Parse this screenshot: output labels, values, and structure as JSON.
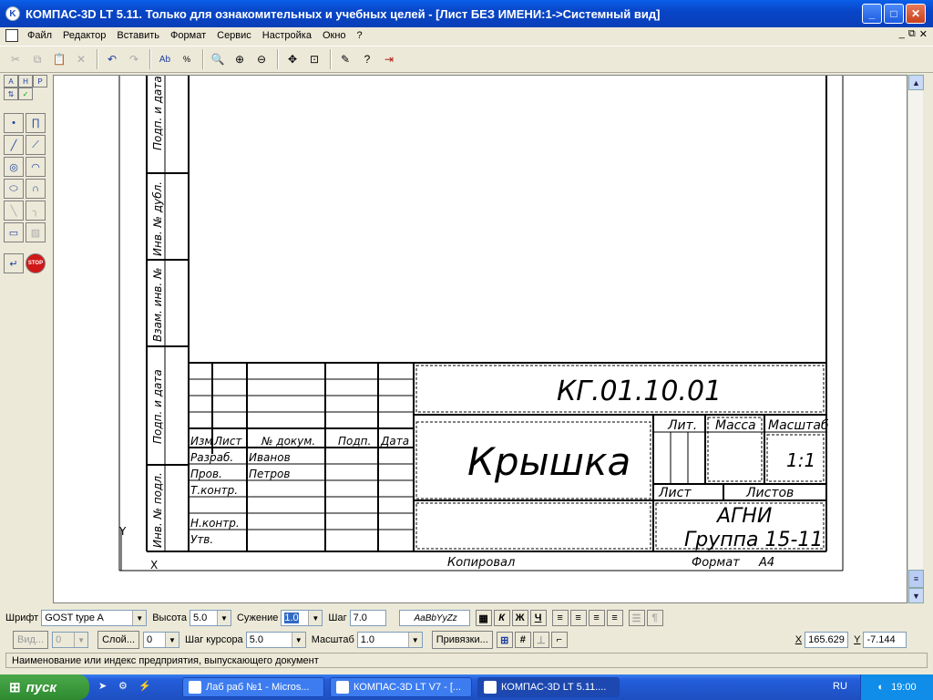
{
  "window": {
    "title": "КОМПАС-3D LT 5.11. Только для ознакомительных и учебных целей - [Лист БЕЗ ИМЕНИ:1->Системный вид]"
  },
  "menu": [
    "Файл",
    "Редактор",
    "Вставить",
    "Формат",
    "Сервис",
    "Настройка",
    "Окно",
    "?"
  ],
  "drawing": {
    "side_labels": [
      "Подп. и дата",
      "Инв. № дубл.",
      "Взам. инв. №",
      "Подп. и дата",
      "Инв. № подл."
    ],
    "stamp": {
      "designation": "КГ.01.10.01",
      "name": "Крышка",
      "org_line1": "АГНИ",
      "org_line2": "Группа 15-11",
      "scale": "1:1",
      "header_cols": [
        "Изм",
        "Лист",
        "№ докум.",
        "Подп.",
        "Дата"
      ],
      "rows": [
        {
          "role": "Разраб.",
          "person": "Иванов"
        },
        {
          "role": "Пров.",
          "person": "Петров"
        },
        {
          "role": "Т.контр.",
          "person": ""
        },
        {
          "role": "",
          "person": ""
        },
        {
          "role": "Н.контр.",
          "person": ""
        },
        {
          "role": "Утв.",
          "person": ""
        }
      ],
      "lit_label": "Лит.",
      "mass_label": "Масса",
      "scale_label": "Масштаб",
      "sheet_label": "Лист",
      "sheets_label": "Листов",
      "copied_label": "Копировал",
      "format_label": "Формат",
      "format_value": "А4"
    },
    "axis_x": "X",
    "axis_y": "Y"
  },
  "params1": {
    "font_label": "Шрифт",
    "font_value": "GOST type A",
    "height_label": "Высота",
    "height_value": "5.0",
    "narrow_label": "Сужение",
    "narrow_value": "1.0",
    "step_label": "Шаг",
    "step_value": "7.0",
    "preview": "AaBbYyZz",
    "italic": "К",
    "bold": "Ж",
    "underline": "Ч"
  },
  "params2": {
    "view_label": "Вид...",
    "view_value": "0",
    "layer_label": "Слой...",
    "layer_value": "0",
    "cursor_label": "Шаг курсора",
    "cursor_value": "5.0",
    "scale_label": "Масштаб",
    "scale_value": "1.0",
    "snap_label": "Привязки...",
    "x_label": "X",
    "x_value": "165.629",
    "y_label": "Y",
    "y_value": "-7.144"
  },
  "status": "Наименование или индекс предприятия, выпускающего документ",
  "taskbar": {
    "start": "пуск",
    "tasks": [
      "Лаб раб №1 - Micros...",
      "КОМПАС-3D LT V7 - [...",
      "КОМПАС-3D LT 5.11...."
    ],
    "lang": "RU",
    "clock": "19:00"
  }
}
